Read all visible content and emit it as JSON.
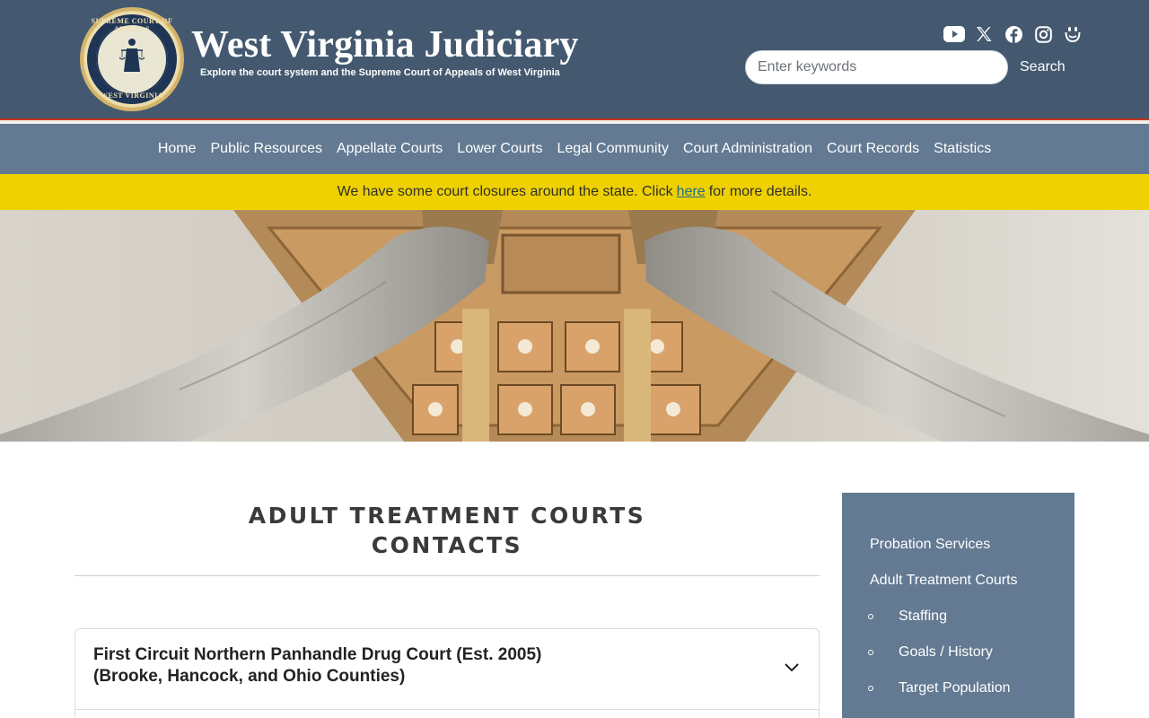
{
  "header": {
    "title": "West Virginia Judiciary",
    "tagline": "Explore the court system and the Supreme Court of Appeals of West Virginia",
    "seal": {
      "text_top": "SUPREME COURT OF APPEALS",
      "text_bottom": "WEST VIRGINIA"
    },
    "socials": [
      "youtube-icon",
      "x-icon",
      "facebook-icon",
      "instagram-icon",
      "smugmug-icon"
    ],
    "search": {
      "placeholder": "Enter keywords",
      "value": "",
      "button_label": "Search"
    }
  },
  "nav": {
    "items": [
      "Home",
      "Public Resources",
      "Appellate Courts",
      "Lower Courts",
      "Legal Community",
      "Court Administration",
      "Court Records",
      "Statistics"
    ]
  },
  "alert": {
    "prefix": "We have some court closures around the state. Click",
    "link_text": "here",
    "suffix": "for more details."
  },
  "main": {
    "heading_line1": "ADULT TREATMENT COURTS",
    "heading_line2": "CONTACTS",
    "accordion": [
      {
        "title_line1": "First Circuit Northern Panhandle Drug Court (Est. 2005)",
        "title_line2": "(Brooke, Hancock, and Ohio Counties)"
      }
    ]
  },
  "sidebar": {
    "items": [
      {
        "label": "Probation Services",
        "level": 0
      },
      {
        "label": "Adult Treatment Courts",
        "level": 0
      },
      {
        "label": "Staffing",
        "level": 1
      },
      {
        "label": "Goals / History",
        "level": 1
      },
      {
        "label": "Target Population",
        "level": 1
      }
    ]
  },
  "colors": {
    "header_bg": "#44596f",
    "nav_bg": "#637a92",
    "alert_bg": "#efd100",
    "accent_red": "#c7361f",
    "sidebar_bg": "#637a92"
  }
}
